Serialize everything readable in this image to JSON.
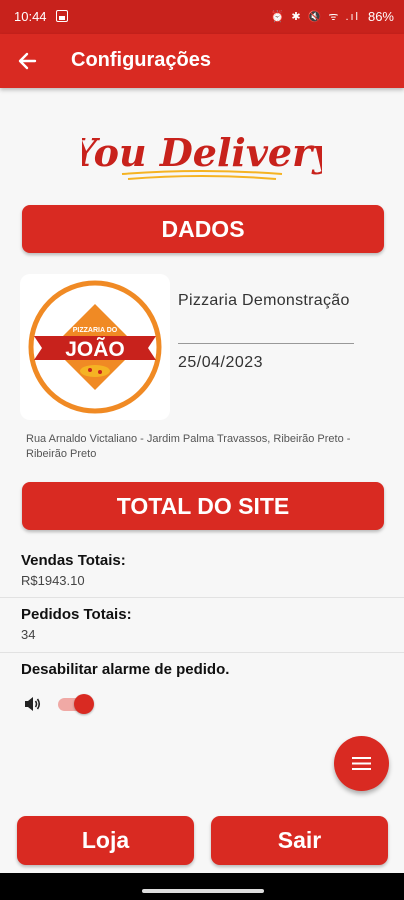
{
  "status_bar": {
    "time": "10:44",
    "icons": "⏰ ✱ 🔇 ᯤ .ıl",
    "battery": "86%"
  },
  "app_bar": {
    "title": "Configurações"
  },
  "brand": {
    "logo_text": "You Delivery",
    "color": "#d92a22"
  },
  "dados_section": {
    "label": "DADOS"
  },
  "store": {
    "logo_top_text": "PIZZARIA DO",
    "logo_name": "JOÃO",
    "name": "Pizzaria Demonstração",
    "date": "25/04/2023",
    "address": "Rua Arnaldo Victaliano - Jardim Palma Travassos, Ribeirão Preto - Ribeirão Preto"
  },
  "total_section": {
    "label": "TOTAL DO SITE"
  },
  "stats": {
    "vendas_label": "Vendas Totais:",
    "vendas_value": "R$1943.10",
    "pedidos_label": "Pedidos Totais:",
    "pedidos_value": "34"
  },
  "alarm": {
    "label": "Desabilitar alarme de pedido.",
    "enabled": true
  },
  "footer": {
    "loja_label": "Loja",
    "sair_label": "Sair"
  }
}
